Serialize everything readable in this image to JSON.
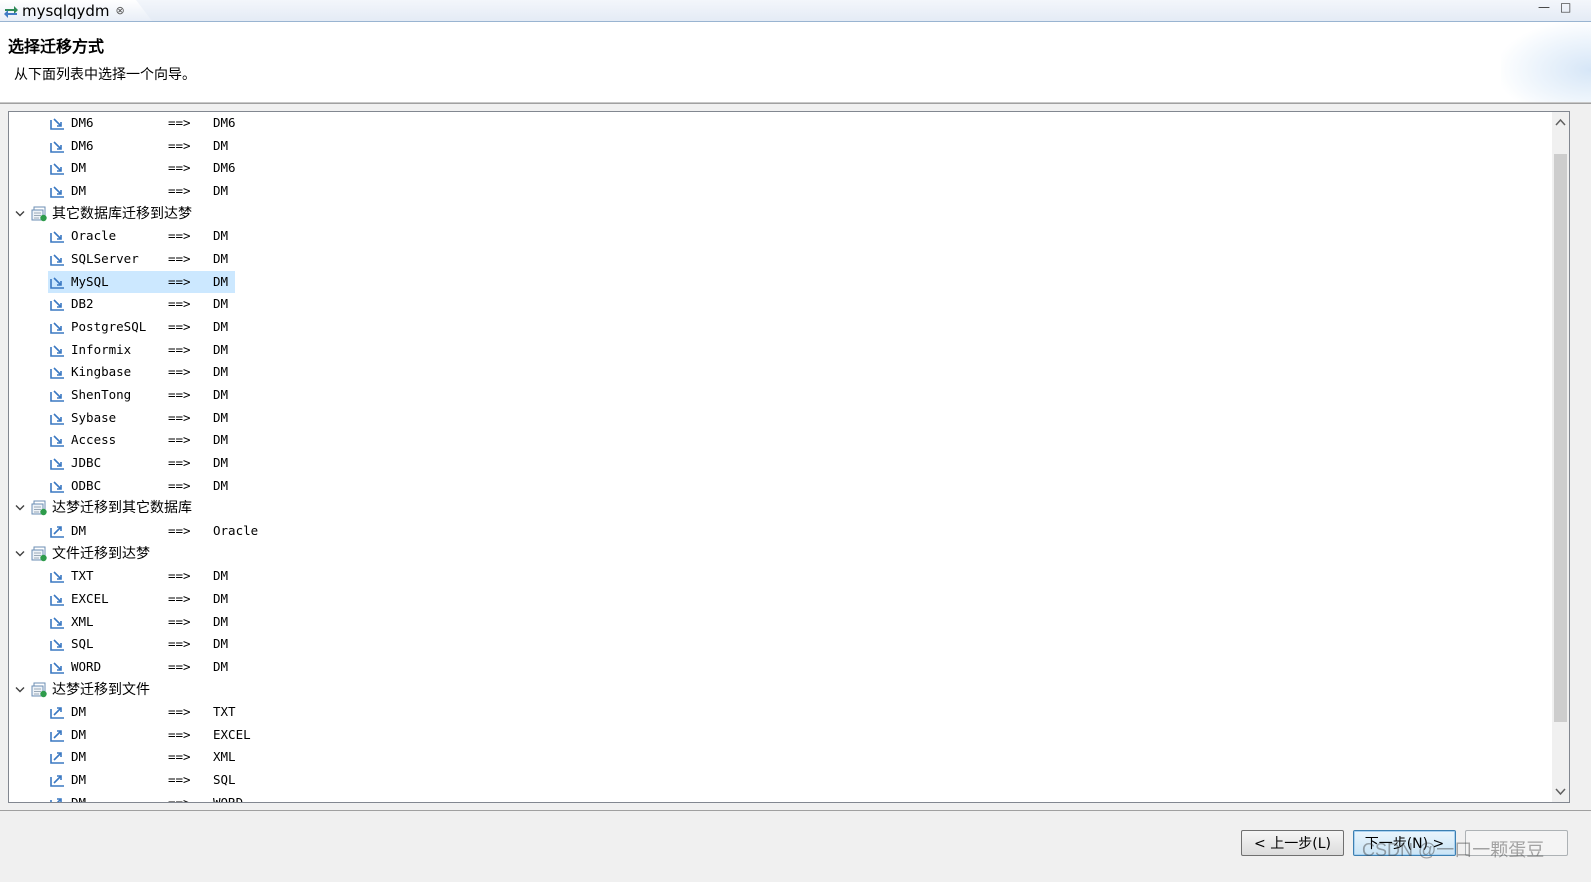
{
  "tab": {
    "title": "mysqlqydm",
    "close_glyph": "⊗"
  },
  "window_controls": {
    "minimize": "—",
    "maximize": "□"
  },
  "header": {
    "title": "选择迁移方式",
    "description": "从下面列表中选择一个向导。"
  },
  "tree": {
    "arrow_text": "==>",
    "top_items": [
      {
        "src": "DM6",
        "dst": "DM6",
        "icon": "import-arrow-icon"
      },
      {
        "src": "DM6",
        "dst": "DM",
        "icon": "import-arrow-icon"
      },
      {
        "src": "DM",
        "dst": "DM6",
        "icon": "import-arrow-icon"
      },
      {
        "src": "DM",
        "dst": "DM",
        "icon": "import-arrow-icon"
      }
    ],
    "categories": [
      {
        "label": "其它数据库迁移到达梦",
        "expanded": true,
        "items": [
          {
            "src": "Oracle",
            "dst": "DM",
            "icon": "import-arrow-icon"
          },
          {
            "src": "SQLServer",
            "dst": "DM",
            "icon": "import-arrow-icon"
          },
          {
            "src": "MySQL",
            "dst": "DM",
            "icon": "import-arrow-icon",
            "selected": true
          },
          {
            "src": "DB2",
            "dst": "DM",
            "icon": "import-arrow-icon"
          },
          {
            "src": "PostgreSQL",
            "dst": "DM",
            "icon": "import-arrow-icon"
          },
          {
            "src": "Informix",
            "dst": "DM",
            "icon": "import-arrow-icon"
          },
          {
            "src": "Kingbase",
            "dst": "DM",
            "icon": "import-arrow-icon"
          },
          {
            "src": "ShenTong",
            "dst": "DM",
            "icon": "import-arrow-icon"
          },
          {
            "src": "Sybase",
            "dst": "DM",
            "icon": "import-arrow-icon"
          },
          {
            "src": "Access",
            "dst": "DM",
            "icon": "import-arrow-icon"
          },
          {
            "src": "JDBC",
            "dst": "DM",
            "icon": "import-arrow-icon"
          },
          {
            "src": "ODBC",
            "dst": "DM",
            "icon": "import-arrow-icon"
          }
        ]
      },
      {
        "label": "达梦迁移到其它数据库",
        "expanded": true,
        "items": [
          {
            "src": "DM",
            "dst": "Oracle",
            "icon": "export-arrow-icon"
          }
        ]
      },
      {
        "label": "文件迁移到达梦",
        "expanded": true,
        "items": [
          {
            "src": "TXT",
            "dst": "DM",
            "icon": "import-arrow-icon"
          },
          {
            "src": "EXCEL",
            "dst": "DM",
            "icon": "import-arrow-icon"
          },
          {
            "src": "XML",
            "dst": "DM",
            "icon": "import-arrow-icon"
          },
          {
            "src": "SQL",
            "dst": "DM",
            "icon": "import-arrow-icon"
          },
          {
            "src": "WORD",
            "dst": "DM",
            "icon": "import-arrow-icon"
          }
        ]
      },
      {
        "label": "达梦迁移到文件",
        "expanded": true,
        "items": [
          {
            "src": "DM",
            "dst": "TXT",
            "icon": "export-arrow-icon"
          },
          {
            "src": "DM",
            "dst": "EXCEL",
            "icon": "export-arrow-icon"
          },
          {
            "src": "DM",
            "dst": "XML",
            "icon": "export-arrow-icon"
          },
          {
            "src": "DM",
            "dst": "SQL",
            "icon": "export-arrow-icon"
          },
          {
            "src": "DM",
            "dst": "WORD",
            "icon": "export-arrow-icon"
          }
        ]
      }
    ]
  },
  "buttons": {
    "back": "< 上一步(L)",
    "next": "下一步(N) >",
    "finish": ""
  },
  "watermark": "CSDN @一口一颗蛋豆",
  "colors": {
    "selection": "#cce8ff",
    "accent": "#3c7fb1"
  }
}
